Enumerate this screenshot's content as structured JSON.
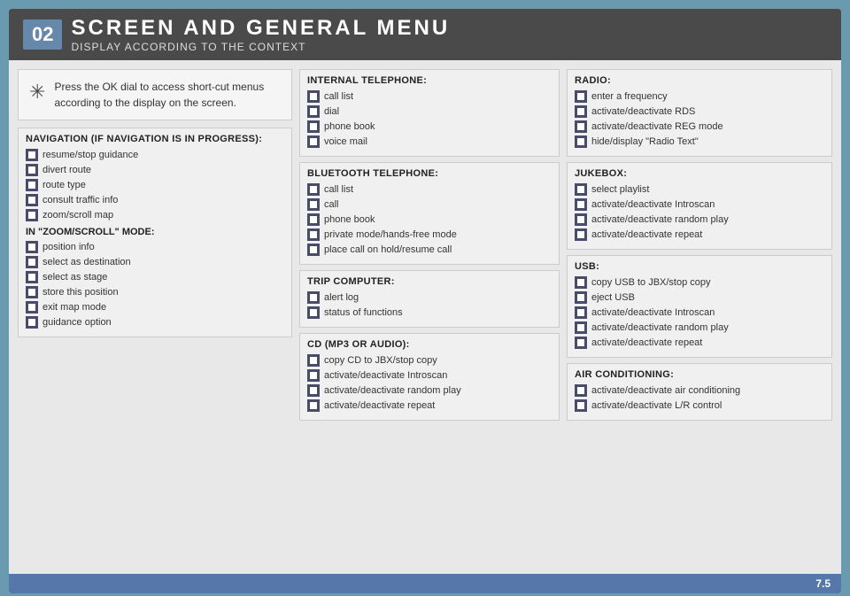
{
  "header": {
    "number": "02",
    "title": "SCREEN AND GENERAL MENU",
    "subtitle": "DISPLAY ACCORDING TO THE CONTEXT"
  },
  "info_box": {
    "text": "Press the OK dial to access short-cut menus according to the display on the screen."
  },
  "navigation": {
    "title": "NAVIGATION (IF NAVIGATION IS IN PROGRESS):",
    "items": [
      "resume/stop guidance",
      "divert route",
      "route type",
      "consult traffic info",
      "zoom/scroll map"
    ],
    "zoom_mode_title": "IN \"ZOOM/SCROLL\" MODE:",
    "zoom_items": [
      "position info",
      "select as destination",
      "select as stage",
      "store this position",
      "exit map mode",
      "guidance option"
    ]
  },
  "internal_telephone": {
    "title": "INTERNAL TELEPHONE:",
    "items": [
      "call list",
      "dial",
      "phone book",
      "voice mail"
    ]
  },
  "bluetooth_telephone": {
    "title": "BLUETOOTH TELEPHONE:",
    "items": [
      "call list",
      "call",
      "phone book",
      "private mode/hands-free mode",
      "place call on hold/resume call"
    ]
  },
  "trip_computer": {
    "title": "TRIP COMPUTER:",
    "items": [
      "alert log",
      "status of functions"
    ]
  },
  "cd_mp3": {
    "title": "CD (MP3 OR AUDIO):",
    "items": [
      "copy CD to JBX/stop copy",
      "activate/deactivate Introscan",
      "activate/deactivate random play",
      "activate/deactivate repeat"
    ]
  },
  "radio": {
    "title": "RADIO:",
    "items": [
      "enter a frequency",
      "activate/deactivate RDS",
      "activate/deactivate REG mode",
      "hide/display \"Radio Text\""
    ]
  },
  "jukebox": {
    "title": "JUKEBOX:",
    "items": [
      "select playlist",
      "activate/deactivate Introscan",
      "activate/deactivate random play",
      "activate/deactivate repeat"
    ]
  },
  "usb": {
    "title": "USB:",
    "items": [
      "copy USB to JBX/stop copy",
      "eject USB",
      "activate/deactivate Introscan",
      "activate/deactivate random play",
      "activate/deactivate repeat"
    ]
  },
  "air_conditioning": {
    "title": "AIR CONDITIONING:",
    "items": [
      "activate/deactivate air conditioning",
      "activate/deactivate L/R control"
    ]
  },
  "page_number": "7.5"
}
